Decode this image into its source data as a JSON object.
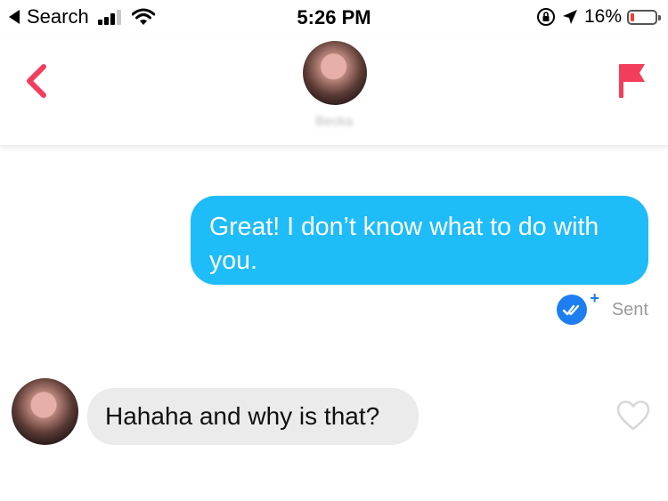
{
  "status_bar": {
    "back_app_label": "Search",
    "time": "5:26 PM",
    "battery_percent": "16%",
    "signal_bars_active": 3,
    "signal_bars_total": 4,
    "battery_level": 0.16,
    "battery_color": "#ff3b30"
  },
  "header": {
    "contact_name": "Becka",
    "back_icon": "chevron-left-icon",
    "report_icon": "flag-icon",
    "accent_color": "#f23e5c"
  },
  "messages": [
    {
      "direction": "outgoing",
      "text": "Great! I don’t know what to do with you.",
      "status": "Sent",
      "status_icon": "double-check-icon",
      "bubble_color": "#1ebcf8"
    },
    {
      "direction": "incoming",
      "text": "Hahaha and why is that?",
      "bubble_color": "#ebebeb",
      "like_icon": "heart-outline-icon"
    }
  ]
}
